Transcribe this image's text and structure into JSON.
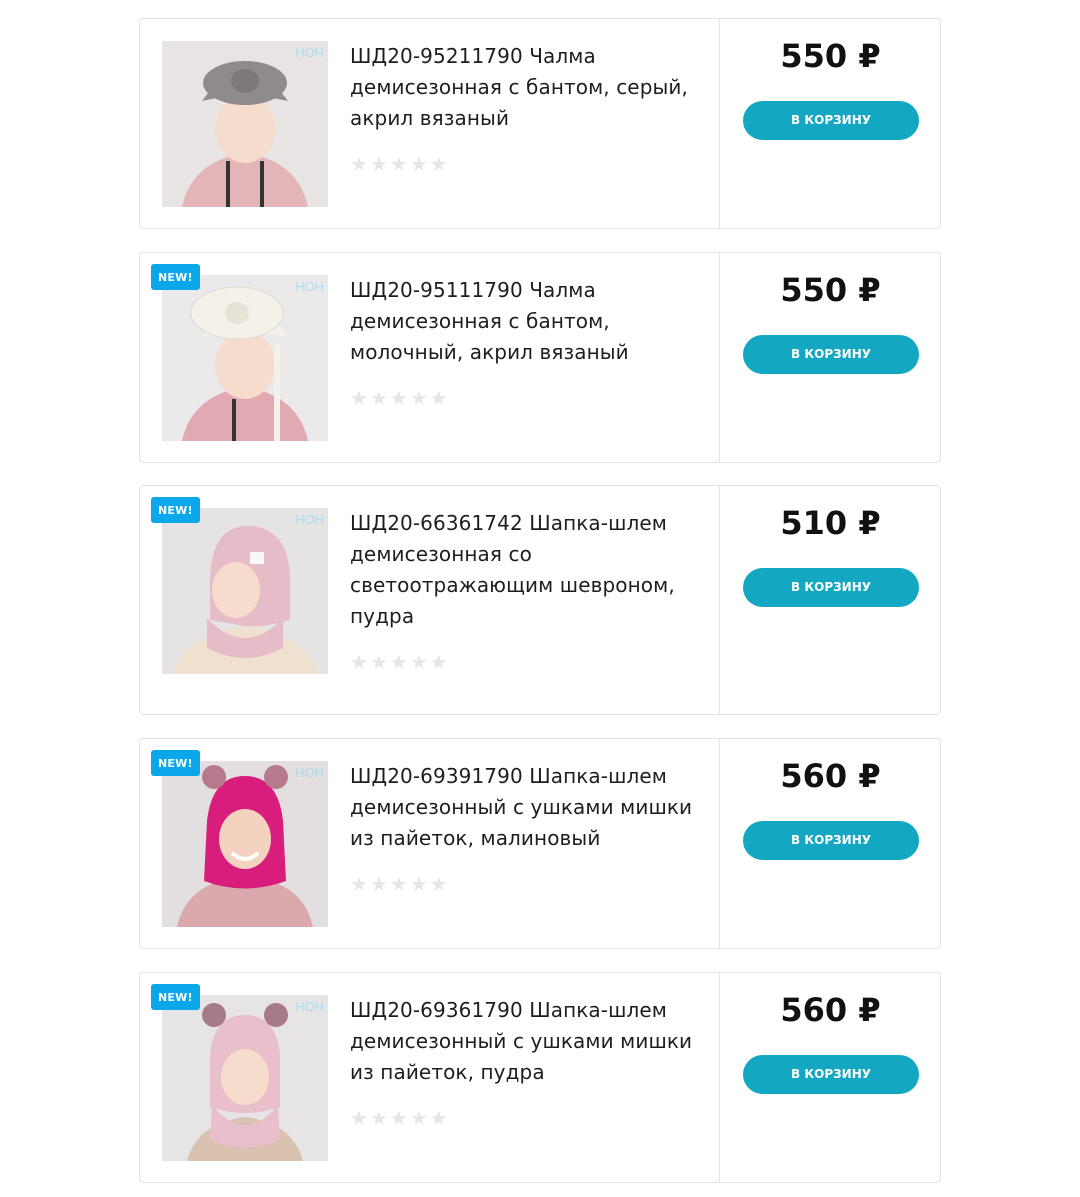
{
  "currency": "₽",
  "add_to_cart_label": "В КОРЗИНУ",
  "new_badge_label": "NEW!",
  "logo_mark": "HOH",
  "products": [
    {
      "title": "ШД20-95211790 Чалма демисезонная с бантом, серый, акрил вязаный",
      "price": "550 ₽",
      "is_new": false,
      "rating": 0,
      "image_colors": {
        "bg": "#e9e4e4",
        "hat": "#8f8b8c",
        "jacket": "#e3b4b8"
      }
    },
    {
      "title": "ШД20-95111790 Чалма демисезонная с бантом, молочный, акрил вязаный",
      "price": "550 ₽",
      "is_new": true,
      "rating": 0,
      "image_colors": {
        "bg": "#ece9ea",
        "hat": "#f3f1ea",
        "jacket": "#e1aab3"
      }
    },
    {
      "title": "ШД20-66361742 Шапка-шлем демисезонная со светоотражающим шевроном, пудра",
      "price": "510 ₽",
      "is_new": true,
      "rating": 0,
      "image_colors": {
        "bg": "#e5e3e4",
        "hat": "#e7bcc9",
        "jacket": "#efe0cf"
      }
    },
    {
      "title": "ШД20-69391790 Шапка-шлем демисезонный с ушками мишки из пайеток, малиновый",
      "price": "560 ₽",
      "is_new": true,
      "rating": 0,
      "image_colors": {
        "bg": "#e3dfe0",
        "hat": "#d81d7d",
        "jacket": "#d9a9ab"
      }
    },
    {
      "title": "ШД20-69361790 Шапка-шлем демисезонный с ушками мишки из пайеток, пудра",
      "price": "560 ₽",
      "is_new": true,
      "rating": 0,
      "image_colors": {
        "bg": "#e6e4e5",
        "hat": "#e9bfcc",
        "jacket": "#d9c3b0"
      }
    }
  ]
}
